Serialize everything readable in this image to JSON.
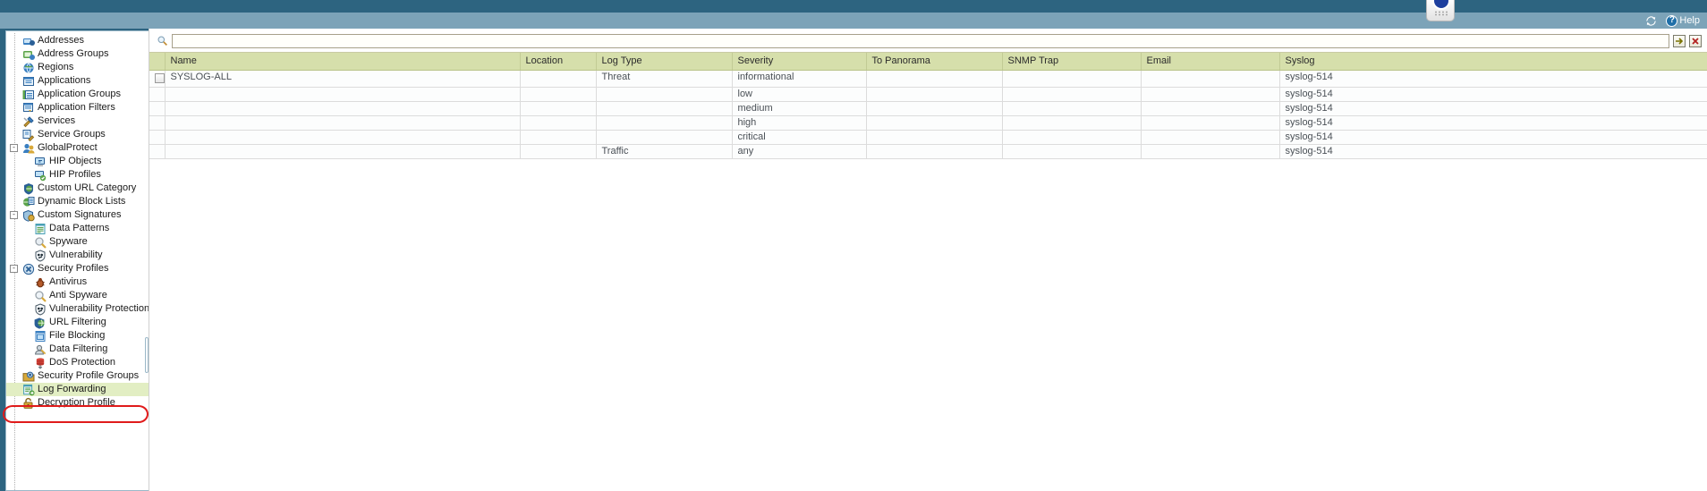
{
  "topbar": {
    "refresh_icon": "refresh-icon",
    "help_label": "Help",
    "help_icon": "help-question-icon",
    "tab_nub_icon": "tab-handle-icon"
  },
  "search": {
    "icon": "search-magnifier-icon",
    "value": "",
    "placeholder": "",
    "apply_icon": "arrow-right-icon",
    "clear_icon": "close-x-icon"
  },
  "sidebar": {
    "items": [
      {
        "label": "Addresses",
        "icon": "addresses-icon",
        "level": 0,
        "twisty": "",
        "selected": false
      },
      {
        "label": "Address Groups",
        "icon": "address-groups-icon",
        "level": 0,
        "twisty": "",
        "selected": false
      },
      {
        "label": "Regions",
        "icon": "regions-globe-icon",
        "level": 0,
        "twisty": "",
        "selected": false
      },
      {
        "label": "Applications",
        "icon": "applications-grid-icon",
        "level": 0,
        "twisty": "",
        "selected": false
      },
      {
        "label": "Application Groups",
        "icon": "application-groups-icon",
        "level": 0,
        "twisty": "",
        "selected": false
      },
      {
        "label": "Application Filters",
        "icon": "application-filters-icon",
        "level": 0,
        "twisty": "",
        "selected": false
      },
      {
        "label": "Services",
        "icon": "services-tools-icon",
        "level": 0,
        "twisty": "",
        "selected": false
      },
      {
        "label": "Service Groups",
        "icon": "service-groups-icon",
        "level": 0,
        "twisty": "",
        "selected": false
      },
      {
        "label": "GlobalProtect",
        "icon": "globalprotect-users-icon",
        "level": 0,
        "twisty": "-",
        "selected": false
      },
      {
        "label": "HIP Objects",
        "icon": "hip-objects-icon",
        "level": 1,
        "twisty": "",
        "selected": false
      },
      {
        "label": "HIP Profiles",
        "icon": "hip-profiles-icon",
        "level": 1,
        "twisty": "",
        "selected": false
      },
      {
        "label": "Custom URL Category",
        "icon": "custom-url-category-icon",
        "level": 0,
        "twisty": "",
        "selected": false
      },
      {
        "label": "Dynamic Block Lists",
        "icon": "dynamic-block-lists-icon",
        "level": 0,
        "twisty": "",
        "selected": false
      },
      {
        "label": "Custom Signatures",
        "icon": "custom-signatures-icon",
        "level": 0,
        "twisty": "-",
        "selected": false
      },
      {
        "label": "Data Patterns",
        "icon": "data-patterns-icon",
        "level": 1,
        "twisty": "",
        "selected": false
      },
      {
        "label": "Spyware",
        "icon": "spyware-magnifier-icon",
        "level": 1,
        "twisty": "",
        "selected": false
      },
      {
        "label": "Vulnerability",
        "icon": "vulnerability-shield-icon",
        "level": 1,
        "twisty": "",
        "selected": false
      },
      {
        "label": "Security Profiles",
        "icon": "security-profiles-icon",
        "level": 0,
        "twisty": "-",
        "selected": false
      },
      {
        "label": "Antivirus",
        "icon": "antivirus-bug-icon",
        "level": 1,
        "twisty": "",
        "selected": false
      },
      {
        "label": "Anti Spyware",
        "icon": "anti-spyware-icon",
        "level": 1,
        "twisty": "",
        "selected": false
      },
      {
        "label": "Vulnerability Protection",
        "icon": "vulnerability-protection-icon",
        "level": 1,
        "twisty": "",
        "selected": false
      },
      {
        "label": "URL Filtering",
        "icon": "url-filtering-globe-icon",
        "level": 1,
        "twisty": "",
        "selected": false
      },
      {
        "label": "File Blocking",
        "icon": "file-blocking-icon",
        "level": 1,
        "twisty": "",
        "selected": false
      },
      {
        "label": "Data Filtering",
        "icon": "data-filtering-icon",
        "level": 1,
        "twisty": "",
        "selected": false
      },
      {
        "label": "DoS Protection",
        "icon": "dos-protection-icon",
        "level": 1,
        "twisty": "",
        "selected": false
      },
      {
        "label": "Security Profile Groups",
        "icon": "security-profile-groups-icon",
        "level": 0,
        "twisty": "",
        "selected": false
      },
      {
        "label": "Log Forwarding",
        "icon": "log-forwarding-icon",
        "level": 0,
        "twisty": "",
        "selected": true
      },
      {
        "label": "Decryption Profile",
        "icon": "decryption-profile-icon",
        "level": 0,
        "twisty": "",
        "selected": false
      }
    ],
    "highlight_color": "#e01b1b",
    "selected_bg": "#e2eec3"
  },
  "table": {
    "columns": [
      "Name",
      "Location",
      "Log Type",
      "Severity",
      "To Panorama",
      "SNMP Trap",
      "Email",
      "Syslog"
    ],
    "rows": [
      {
        "checkbox": true,
        "name": "SYSLOG-ALL",
        "location": "",
        "log_type": "Threat",
        "severity": "informational",
        "to_panorama": "",
        "snmp_trap": "",
        "email": "",
        "syslog": "syslog-514"
      },
      {
        "checkbox": false,
        "name": "",
        "location": "",
        "log_type": "",
        "severity": "low",
        "to_panorama": "",
        "snmp_trap": "",
        "email": "",
        "syslog": "syslog-514"
      },
      {
        "checkbox": false,
        "name": "",
        "location": "",
        "log_type": "",
        "severity": "medium",
        "to_panorama": "",
        "snmp_trap": "",
        "email": "",
        "syslog": "syslog-514"
      },
      {
        "checkbox": false,
        "name": "",
        "location": "",
        "log_type": "",
        "severity": "high",
        "to_panorama": "",
        "snmp_trap": "",
        "email": "",
        "syslog": "syslog-514"
      },
      {
        "checkbox": false,
        "name": "",
        "location": "",
        "log_type": "",
        "severity": "critical",
        "to_panorama": "",
        "snmp_trap": "",
        "email": "",
        "syslog": "syslog-514"
      },
      {
        "checkbox": false,
        "name": "",
        "location": "",
        "log_type": "Traffic",
        "severity": "any",
        "to_panorama": "",
        "snmp_trap": "",
        "email": "",
        "syslog": "syslog-514"
      }
    ],
    "header_bg": "#d6dfab"
  }
}
